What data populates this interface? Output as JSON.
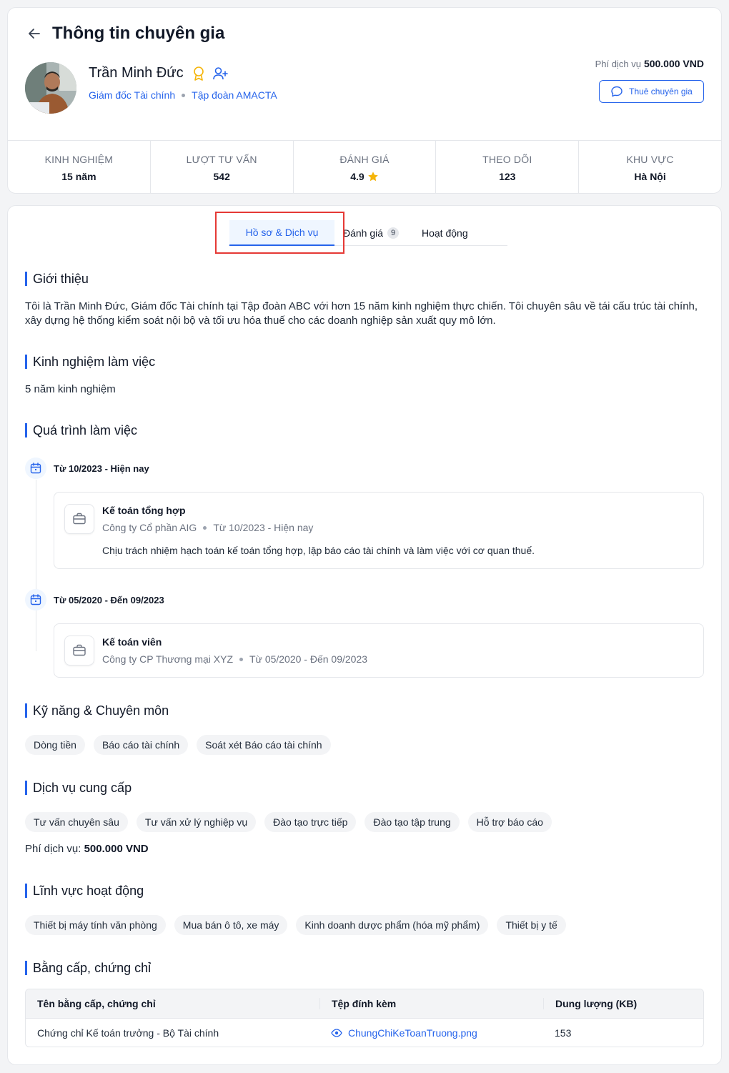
{
  "header": {
    "title": "Thông tin chuyên gia",
    "expert_name": "Trần Minh Đức",
    "position": "Giám đốc Tài chính",
    "company": "Tập đoàn AMACTA",
    "fee_label": "Phí dịch vụ",
    "fee_value": "500.000 VND",
    "hire_button": "Thuê chuyên gia"
  },
  "stats": [
    {
      "label": "KINH NGHIỆM",
      "value": "15 năm"
    },
    {
      "label": "LƯỢT TƯ VẤN",
      "value": "542"
    },
    {
      "label": "ĐÁNH GIÁ",
      "value": "4.9"
    },
    {
      "label": "THEO DÕI",
      "value": "123"
    },
    {
      "label": "KHU VỰC",
      "value": "Hà Nội"
    }
  ],
  "tabs": {
    "profile": "Hồ sơ & Dịch vụ",
    "reviews": "Đánh giá",
    "reviews_count": "9",
    "activity": "Hoạt động"
  },
  "intro": {
    "title": "Giới thiệu",
    "text": "Tôi là Trần Minh Đức, Giám đốc Tài chính tại Tập đoàn ABC với hơn 15 năm kinh nghiệm thực chiến. Tôi chuyên sâu về tái cấu trúc tài chính, xây dựng hệ thống kiểm soát nội bộ và tối ưu hóa thuế cho các doanh nghiệp sản xuất quy mô lớn."
  },
  "experience": {
    "title": "Kinh nghiệm làm việc",
    "text": "5 năm kinh nghiệm"
  },
  "work_history": {
    "title": "Quá trình làm việc",
    "items": [
      {
        "date": "Từ 10/2023 - Hiện nay",
        "job_title": "Kế toán tổng hợp",
        "company": "Công ty Cổ phần AIG",
        "period": "Từ 10/2023 - Hiện nay",
        "description": "Chịu trách nhiệm hạch toán kế toán tổng hợp, lập báo cáo tài chính và làm việc với cơ quan thuế."
      },
      {
        "date": "Từ 05/2020 - Đến 09/2023",
        "job_title": "Kế toán viên",
        "company": "Công ty CP Thương mại XYZ",
        "period": "Từ 05/2020 - Đến 09/2023"
      }
    ]
  },
  "skills": {
    "title": "Kỹ năng & Chuyên môn",
    "items": [
      "Dòng tiền",
      "Báo cáo tài chính",
      "Soát xét Báo cáo tài chính"
    ]
  },
  "services": {
    "title": "Dịch vụ cung cấp",
    "items": [
      "Tư vấn chuyên sâu",
      "Tư vấn xử lý nghiệp vụ",
      "Đào tạo trực tiếp",
      "Đào tạo tập trung",
      "Hỗ trợ báo cáo"
    ],
    "fee_label": "Phí dịch vụ:",
    "fee_value": "500.000 VND"
  },
  "fields": {
    "title": "Lĩnh vực hoạt động",
    "items": [
      "Thiết bị máy tính văn phòng",
      "Mua bán ô tô, xe máy",
      "Kinh doanh dược phẩm (hóa mỹ phẩm)",
      "Thiết bị y tế"
    ]
  },
  "certificates": {
    "title": "Bằng cấp, chứng chỉ",
    "columns": [
      "Tên bằng cấp, chứng chỉ",
      "Tệp đính kèm",
      "Dung lượng (KB)"
    ],
    "rows": [
      {
        "name": "Chứng chỉ Kế toán trưởng - Bộ Tài chính",
        "file": "ChungChiKeToanTruong.png",
        "size": "153"
      }
    ]
  },
  "colors": {
    "accent": "#2563eb",
    "highlight": "#e53935",
    "star": "#f5b50a"
  }
}
